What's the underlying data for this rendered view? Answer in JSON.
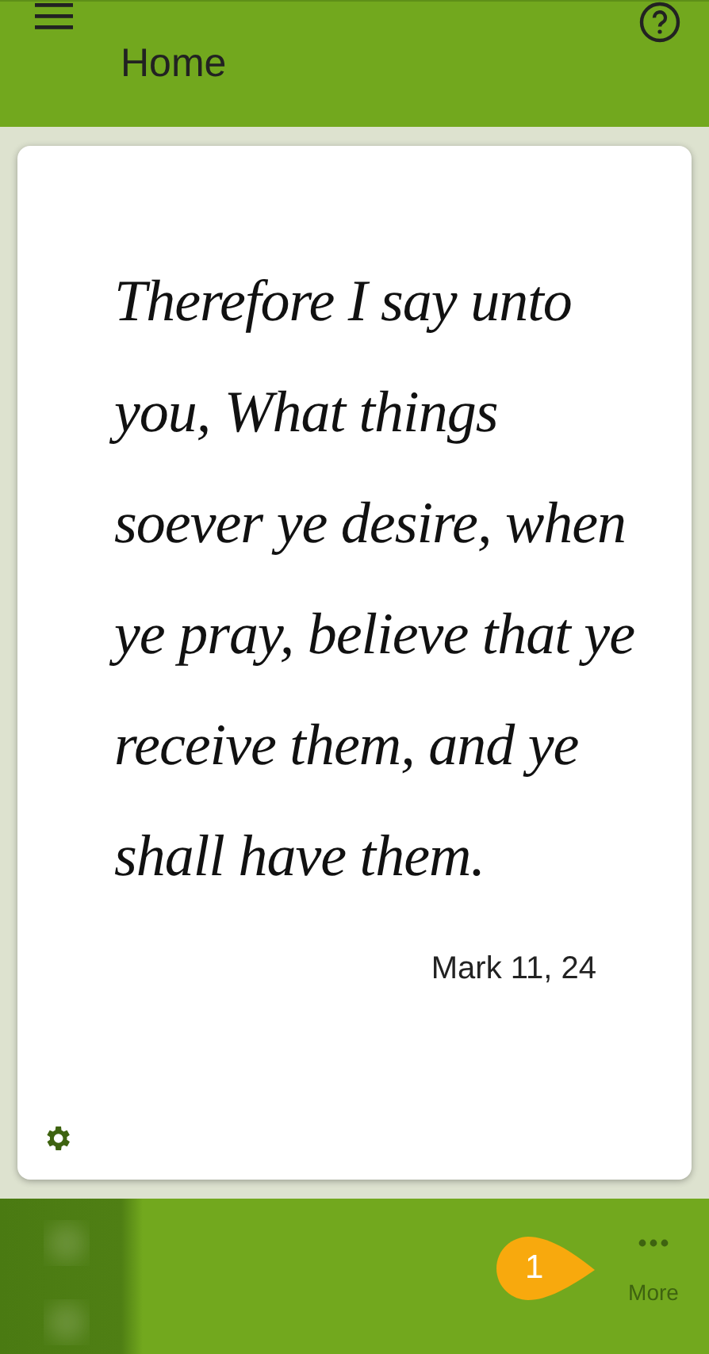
{
  "app_bar": {
    "title": "Home"
  },
  "verse": {
    "text": "Therefore I say unto you, What things soever ye desire, when ye pray, believe that ye receive them, and ye shall have them.",
    "reference": "Mark 11, 24"
  },
  "bottom_bar": {
    "more_label": "More",
    "tutorial_marker": "1"
  }
}
